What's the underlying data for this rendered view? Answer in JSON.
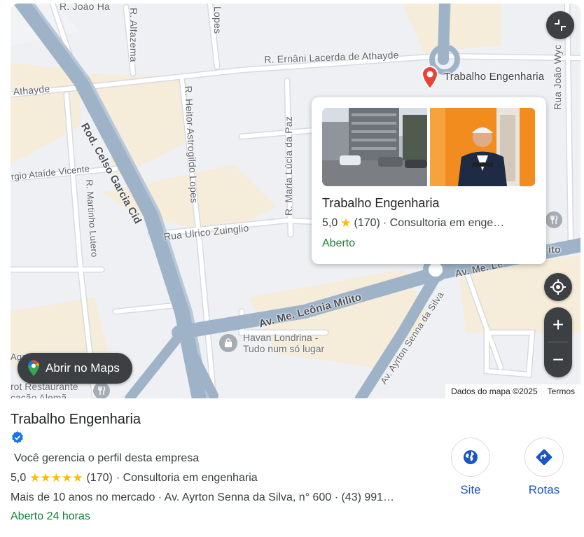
{
  "map": {
    "streets": [
      "R. João Ha",
      "R. Alfazema",
      "Lopes",
      "R. Ernâni Lacerda de Athayde",
      "Athayde",
      "Rod. Celso Garcia Cid",
      "R. Heitor Astrogildo Lopes",
      "R. Maria Lúcia da Paz",
      "Rua João Wyc",
      "rgio Ataíde Vicente",
      "R. Martinho Lutero",
      "Rua Ulrico Zuinglio",
      "Av. Me. Leônia Milito",
      "Av. Me. Le",
      "ito",
      "Av. Ayrton Senna da Silva",
      "Agawa"
    ],
    "places": {
      "havan": "Havan Londrina -\nTudo num só lugar",
      "restaurant": "rot Restaurante\ncação Alemã"
    },
    "pin_label": "Trabalho Engenharia",
    "open_in_maps_label": "Abrir no Maps",
    "attribution": "Dados do mapa ©2025",
    "terms": "Termos",
    "zoom_in": "+",
    "zoom_out": "−"
  },
  "card": {
    "title": "Trabalho Engenharia",
    "rating": "5,0",
    "reviews": "(170)",
    "category": "· Consultoria em enge…",
    "status": "Aberto"
  },
  "panel": {
    "name": "Trabalho Engenharia",
    "manage_text": "Você gerencia o perfil desta empresa",
    "rating": "5,0",
    "stars": 5,
    "reviews": "(170)",
    "category": "· Consultoria em engenharia",
    "description": "Mais de 10 anos no mercado · Av. Ayrton Senna da Silva, n° 600 · (43) 991…",
    "hours": "Aberto 24 horas"
  },
  "actions": {
    "site": "Site",
    "directions": "Rotas"
  },
  "colors": {
    "star": "#fbbc04",
    "open_green": "#188038",
    "link_blue": "#1a56c4",
    "pin_red": "#ea4335",
    "verified_blue": "#1a73e8"
  }
}
